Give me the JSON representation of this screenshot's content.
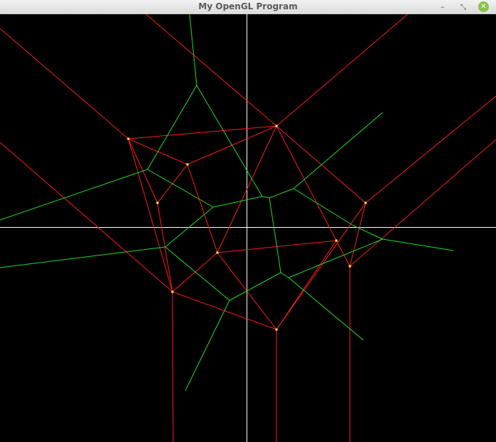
{
  "window": {
    "title": "My OpenGL Program",
    "minimize_glyph": "–",
    "restore_glyph": "⤡",
    "close_glyph": "✕"
  },
  "colors": {
    "background": "#000000",
    "axes": "#ffffff",
    "delaunay_edges": "#ff1a1a",
    "voronoi_edges": "#22dd22",
    "sites": "#ffff33"
  }
}
